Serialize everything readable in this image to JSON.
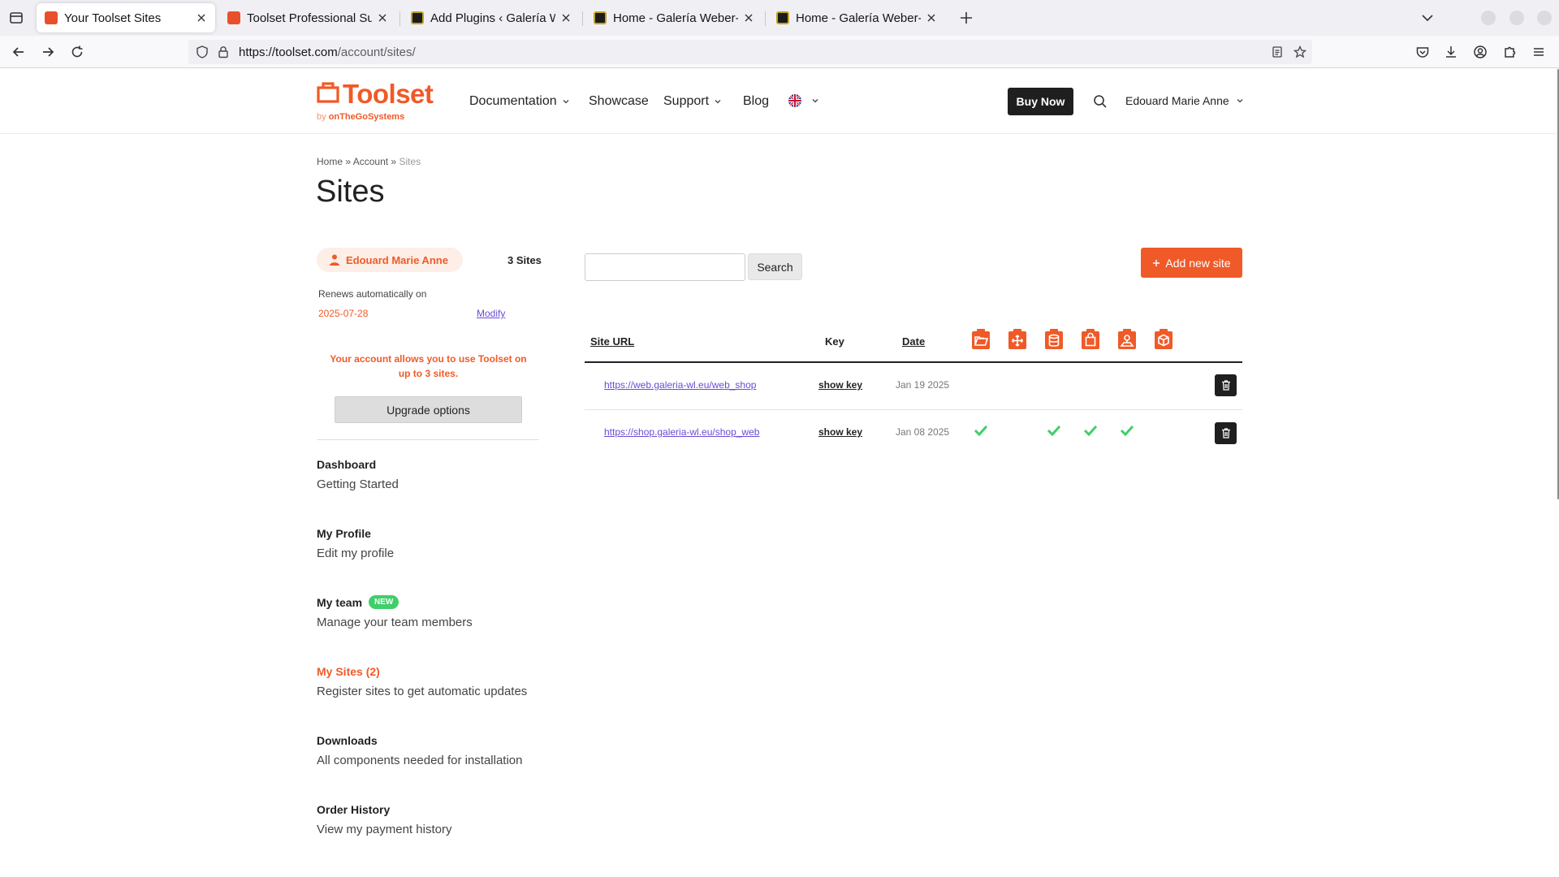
{
  "browser": {
    "tabs": [
      {
        "title": "Your Toolset Sites",
        "favicon": "toolset-favicon"
      },
      {
        "title": "Toolset Professional Supp",
        "favicon": "toolset-favicon"
      },
      {
        "title": "Add Plugins ‹ Galería Web",
        "favicon": "galeria-favicon"
      },
      {
        "title": "Home - Galería Weber-Lut",
        "favicon": "galeria-favicon"
      },
      {
        "title": "Home - Galería Weber-Lut",
        "favicon": "galeria-favicon"
      }
    ],
    "url_domain": "https://toolset.com",
    "url_path": "/account/sites/"
  },
  "header": {
    "logo_word": "Toolset",
    "logo_by": "by",
    "logo_company": "onTheGoSystems",
    "nav": [
      "Documentation",
      "Showcase",
      "Support",
      "Blog"
    ],
    "buy_now": "Buy Now",
    "user_name": "Edouard Marie Anne"
  },
  "breadcrumb": {
    "home": "Home",
    "sep": "»",
    "account": "Account",
    "current": "Sites"
  },
  "page_title": "Sites",
  "sidebar": {
    "user_name": "Edouard Marie Anne",
    "sites_count": "3 Sites",
    "renews_label": "Renews automatically on",
    "renew_date": "2025-07-28",
    "modify_label": "Modify",
    "allow_message": "Your account allows you to use Toolset on up to 3 sites.",
    "upgrade_label": "Upgrade options",
    "items": [
      {
        "title": "Dashboard",
        "desc": "Getting Started"
      },
      {
        "title": "My Profile",
        "desc": "Edit my profile"
      },
      {
        "title": "My team",
        "desc": "Manage your team members",
        "badge": "NEW"
      },
      {
        "title": "My Sites (2)",
        "desc": "Register sites to get automatic updates"
      },
      {
        "title": "Downloads",
        "desc": "All components needed for installation"
      },
      {
        "title": "Order History",
        "desc": "View my payment history"
      }
    ]
  },
  "main": {
    "search_value": "",
    "search_label": "Search",
    "add_site_label": "Add new site",
    "columns": {
      "site_url": "Site URL",
      "key": "Key",
      "date": "Date"
    },
    "plugin_icons": [
      "folder-icon",
      "arrows-icon",
      "database-icon",
      "bag-icon",
      "map-icon",
      "box-icon"
    ],
    "rows": [
      {
        "url": "https://web.galeria-wl.eu/web_shop",
        "key": "show key",
        "date": "Jan 19 2025",
        "checks": [
          false,
          false,
          false,
          false,
          false,
          false
        ]
      },
      {
        "url": "https://shop.galeria-wl.eu/shop_web",
        "key": "show key",
        "date": "Jan 08 2025",
        "checks": [
          true,
          false,
          true,
          true,
          true,
          false
        ]
      }
    ]
  },
  "colors": {
    "accent": "#f05a28",
    "link": "#6a4bd6",
    "check": "#3fcf6a",
    "dark": "#1f1f1f"
  }
}
